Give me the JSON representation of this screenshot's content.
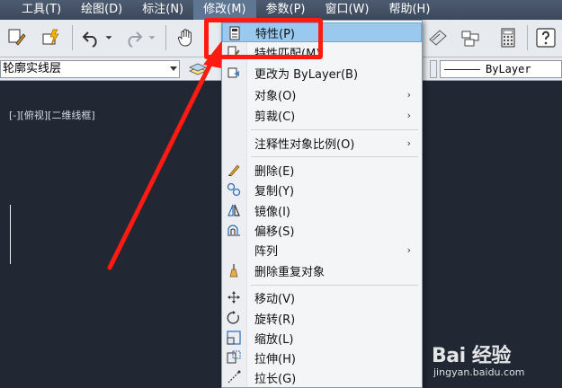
{
  "menubar": {
    "items": [
      {
        "label": "工具(T)"
      },
      {
        "label": "绘图(D)"
      },
      {
        "label": "标注(N)"
      },
      {
        "label": "修改(M)"
      },
      {
        "label": "参数(P)"
      },
      {
        "label": "窗口(W)"
      },
      {
        "label": "帮助(H)"
      }
    ]
  },
  "proprow": {
    "layer": "轮廓实线层",
    "linetype": "ByLayer"
  },
  "viewport": {
    "label": "[-][俯视][二维线框]"
  },
  "modify_menu": {
    "items": [
      {
        "label": "特性(P)",
        "icon": "properties-icon"
      },
      {
        "label": "特性匹配(M)",
        "icon": "match-properties-icon"
      },
      {
        "label": "更改为 ByLayer(B)",
        "icon": "bylayer-icon"
      },
      {
        "label": "对象(O)",
        "icon": "",
        "submenu": true
      },
      {
        "label": "剪裁(C)",
        "icon": "",
        "submenu": true
      },
      {
        "label": "注释性对象比例(O)",
        "icon": "",
        "submenu": true
      },
      {
        "label": "删除(E)",
        "icon": "erase-icon"
      },
      {
        "label": "复制(Y)",
        "icon": "copy-icon"
      },
      {
        "label": "镜像(I)",
        "icon": "mirror-icon"
      },
      {
        "label": "偏移(S)",
        "icon": "offset-icon"
      },
      {
        "label": "阵列",
        "icon": "",
        "submenu": true
      },
      {
        "label": "删除重复对象",
        "icon": "delete-duplicates-icon"
      },
      {
        "label": "移动(V)",
        "icon": "move-icon"
      },
      {
        "label": "旋转(R)",
        "icon": "rotate-icon"
      },
      {
        "label": "缩放(L)",
        "icon": "scale-icon"
      },
      {
        "label": "拉伸(H)",
        "icon": "stretch-icon"
      },
      {
        "label": "拉长(G)",
        "icon": "lengthen-icon"
      }
    ],
    "submenu_arrow": "›"
  },
  "watermark": {
    "brand": "Bai 经验",
    "url": "jingyan.baidu.com"
  },
  "colors": {
    "annotation_red": "#ff1a12",
    "menu_highlight": "#99c9ef",
    "menubar_bg": "#3c495c",
    "canvas_bg": "#212833"
  }
}
